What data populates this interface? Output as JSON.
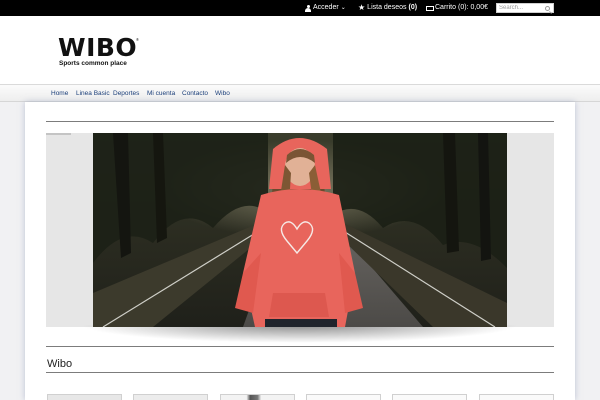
{
  "topbar": {
    "login_label": "Acceder",
    "wishlist_label": "Lista deseos",
    "wishlist_count": "(0)",
    "cart_label": "Carrito",
    "cart_summary": "(0): 0,00€",
    "search_placeholder": "Search..."
  },
  "header": {
    "logo_text": "WIBO",
    "logo_tagline": "Sports common place"
  },
  "nav": {
    "items": [
      {
        "label": "Home"
      },
      {
        "label": "Linea Basic"
      },
      {
        "label": "Deportes"
      },
      {
        "label": "Mi cuenta"
      },
      {
        "label": "Contacto"
      },
      {
        "label": "Wibo"
      }
    ]
  },
  "section": {
    "title": "Wibo"
  },
  "colors": {
    "topbar_bg": "#000000",
    "nav_text": "#1b3f7a",
    "hoodie": "#e8655c"
  }
}
